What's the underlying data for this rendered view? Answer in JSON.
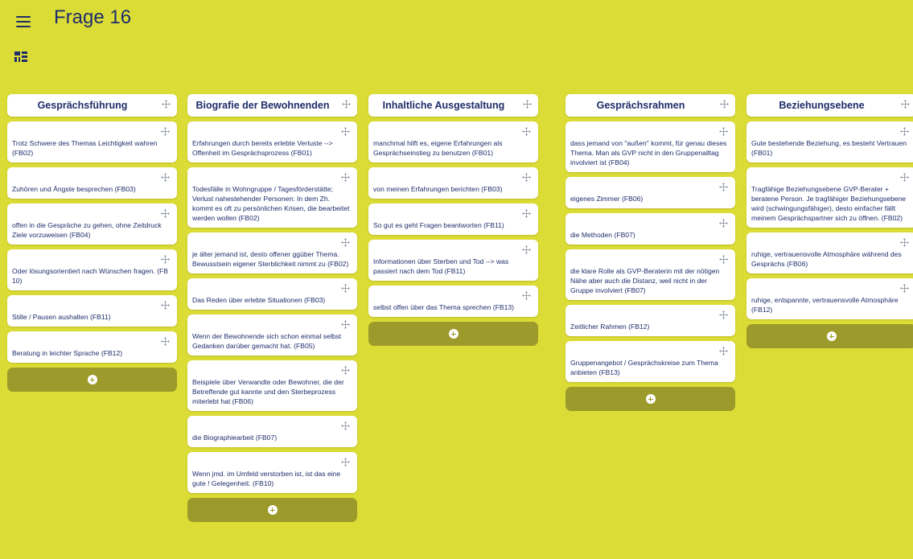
{
  "header": {
    "title": "Frage 16",
    "menu_icon": "hamburger-menu-icon",
    "view_icon": "grid-layout-icon"
  },
  "colors": {
    "background": "#dcdc36",
    "text": "#1f2d6b",
    "add_button": "#9c9a2a"
  },
  "columns": [
    {
      "title": "Gesprächsführung",
      "cards": [
        "Trotz Schwere des Themas Leichtigkeit wahren (FB02)",
        "Zuhören und Ängste besprechen (FB03)",
        "offen in die Gespräche zu gehen, ohne Zeitdruck Ziele vorzuweisen (FB04)",
        "Oder lösungsorientiert nach Wünschen fragen. (FB 10)",
        "Stille / Pausen aushalten (FB11)",
        "Beratung in leichter Sprache (FB12)"
      ]
    },
    {
      "title": "Biografie der Bewohnenden",
      "cards": [
        "Erfahrungen durch bereits erlebte Verluste --> Offenheit im Gesprächsprozess (FB01)",
        "Todesfälle in Wohngruppe / Tagesförderstätte; Verlust nahestehender Personen: In dem Zh. kommt es oft zu persönlichen Krisen, die bearbeitet werden wollen (FB02)",
        "je älter jemand ist, desto offener ggüber Thema. Bewusstsein eigener Sterblichkeit nimmt zu (FB02)",
        "Das Reden über erlebte Situationen (FB03)",
        "Wenn der Bewohnende sich schon einmal selbst Gedanken darüber gemacht hat. (FB05)",
        "Beispiele über Verwandte oder Bewohner, die der Betreffende gut kannte und den Sterbeprozess miterlebt hat (FB06)",
        "die Biographiearbeit (FB07)",
        "Wenn jmd. im Umfeld verstorben ist, ist das eine gute ! Gelegenheit. (FB10)"
      ]
    },
    {
      "title": "Inhaltliche Ausgestaltung",
      "cards": [
        "manchmal hilft es, eigene Erfahrungen als Gesprächseinstieg zu benutzen (FB01)",
        "von meinen Erfahrungen berichten (FB03)",
        "So gut es geht Fragen beantworten (FB11)",
        "Informationen über Sterben und Tod --> was passiert nach dem Tod (FB11)",
        "selbst offen über das Thema sprechen (FB13)"
      ]
    },
    {
      "title": "Gesprächsrahmen",
      "cards": [
        "dass jemand von \"außen\" kommt, für genau dieses Thema. Man als GVP nicht in den Gruppenalltag involviert ist (FB04)",
        "eigenes Zimmer (FB06)",
        "die Methoden (FB07)",
        "die klare Rolle als GVP-Beraterin mit der nötigen Nähe aber auch die Distanz, weil nicht in der Gruppe involviert (FB07)",
        "Zeitlicher Rahmen (FB12)",
        "Gruppenangebot / Gesprächskreise zum Thema anbieten (FB13)"
      ]
    },
    {
      "title": "Beziehungsebene",
      "cards": [
        "Gute bestehende Beziehung, es besteht Vertrauen (FB01)",
        "Tragfähige Beziehungsebene GVP-Berater + beratene Person. Je tragfähiger Beziehungsebene wird (schwingungsfähiger), desto einfacher fällt meinem Gesprächspartner sich zu öffnen. (FB02)",
        "ruhige, vertrauensvolle Atmosphäre während des Gesprächs (FB06)",
        "ruhige, entspannte, vertrauensvolle Atmosphäre (FB12)"
      ]
    }
  ]
}
